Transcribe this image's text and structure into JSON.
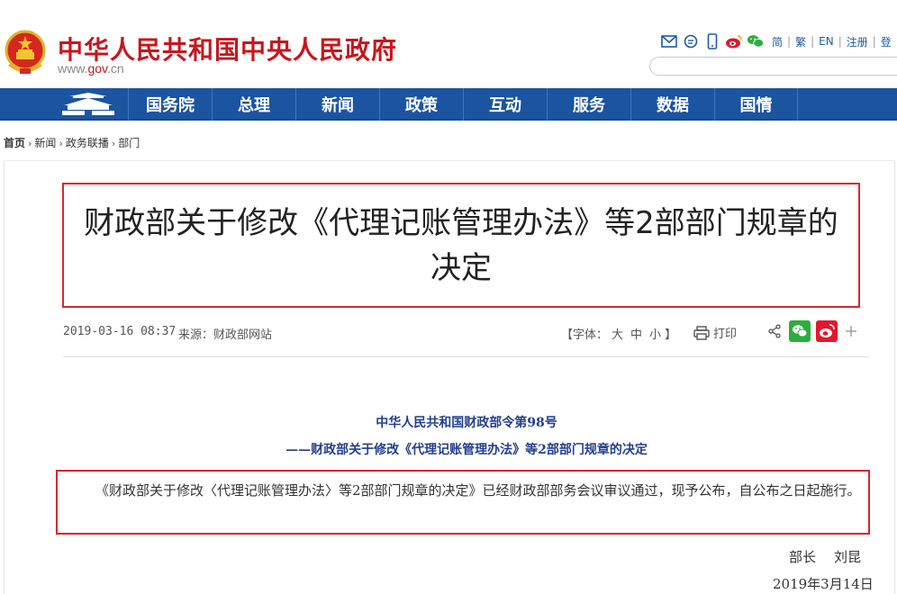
{
  "header": {
    "site_title": "中华人民共和国中央人民政府",
    "site_url_prefix": "www.",
    "site_url_domain": "gov",
    "site_url_suffix": ".cn",
    "tool_icons": [
      "mail-icon",
      "chat-icon",
      "mobile-icon",
      "weibo-icon",
      "wechat-icon"
    ],
    "lang_links": [
      "简",
      "繁",
      "EN",
      "注册",
      "登"
    ],
    "search_placeholder": ""
  },
  "nav": {
    "items": [
      "国务院",
      "总理",
      "新闻",
      "政策",
      "互动",
      "服务",
      "数据",
      "国情"
    ]
  },
  "breadcrumb": {
    "items": [
      "首页",
      "新闻",
      "政务联播",
      "部门"
    ],
    "separator": "›"
  },
  "article": {
    "title": "财政部关于修改《代理记账管理办法》等2部部门规章的决定",
    "date": "2019-03-16 08:37",
    "source_label": "来源：",
    "source": "财政部网站",
    "font_label": "【字体：",
    "font_sizes": [
      "大",
      "中",
      "小"
    ],
    "font_end": "】",
    "print_label": "打印",
    "doc_number": "中华人民共和国财政部令第98号",
    "doc_subtitle": "——财政部关于修改《代理记账管理办法》等2部部门规章的决定",
    "paragraph": "《财政部关于修改〈代理记账管理办法〉等2部部门规章的决定》已经财政部部务会议审议通过，现予公布，自公布之日起施行。",
    "signer_title": "部长",
    "signer_name": "刘昆",
    "sign_date": "2019年3月14日"
  },
  "colors": {
    "brand_red": "#c8161d",
    "nav_blue": "#1b54a0",
    "highlight_box": "#d9272e",
    "doc_blue": "#23408f"
  }
}
